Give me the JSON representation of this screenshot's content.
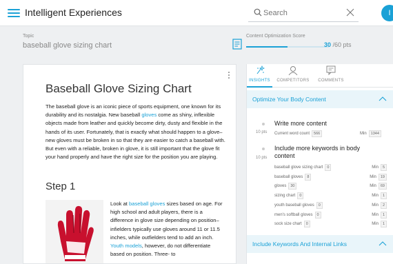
{
  "header": {
    "app_title": "Intelligent Experiences",
    "search_placeholder": "Search",
    "avatar_initial": "I",
    "accent": "#1aa1d6"
  },
  "topic": {
    "label": "Topic",
    "value": "baseball glove sizing chart"
  },
  "score": {
    "label": "Content Optimization Score",
    "value": "30",
    "suffix": "/60 pts",
    "fraction": 0.5
  },
  "article": {
    "title": "Baseball Glove Sizing Chart",
    "intro_1": "The baseball glove is an iconic piece of sports equipment, one known for its durability and its nostalgia. New baseball ",
    "intro_link": "gloves",
    "intro_2": " come as shiny, inflexible objects made from leather and quickly become dirty, dusty and flexible in the hands of its user. Fortunately, that is exactly what should happen to a glove– new gloves must be broken in so that they are easier to catch a baseball with. But even with a reliable, broken in glove, it is still important that the glove fit your hand properly and have the right size for the position you are playing.",
    "step_heading": "Step 1",
    "step_1": "Look at ",
    "step_link_1": "baseball gloves",
    "step_2": " sizes based on age. For high school and adult players, there is a difference in glove size depending on position– infielders typically use gloves around 11 or 11.5 inches, while outfielders tend to add an inch. ",
    "step_link_2": "Youth models",
    "step_3": ", however, do not differentiate based on position. Three- to"
  },
  "panel": {
    "tabs": [
      {
        "label": "INSIGHTS",
        "icon": "sparkle-icon"
      },
      {
        "label": "COMPETITORS",
        "icon": "users-icon"
      },
      {
        "label": "COMMENTS",
        "icon": "comment-icon"
      }
    ],
    "section_1": {
      "title": "Optimize Your Body Content",
      "task_1": {
        "title": "Write more content",
        "points": "10 pts",
        "sub_label": "Current word count",
        "current": "566",
        "min_label": "Min",
        "min_value": "1344"
      },
      "task_2": {
        "title_line_1": "Include more keywords in body",
        "title_line_2": "content",
        "points": "10 pts",
        "keywords": [
          {
            "term": "baseball glove sizing chart",
            "count": "0",
            "min_label": "Min",
            "min": "5"
          },
          {
            "term": "baseball gloves",
            "count": "8",
            "min_label": "Min",
            "min": "19"
          },
          {
            "term": "gloves",
            "count": "30",
            "min_label": "Min",
            "min": "69"
          },
          {
            "term": "sizing chart",
            "count": "0",
            "min_label": "Min",
            "min": "1"
          },
          {
            "term": "youth baseball gloves",
            "count": "0",
            "min_label": "Min",
            "min": "2"
          },
          {
            "term": "men's softball gloves",
            "count": "0",
            "min_label": "Min",
            "min": "1"
          },
          {
            "term": "sock size chart",
            "count": "0",
            "min_label": "Min",
            "min": "1"
          }
        ]
      }
    },
    "section_2": {
      "title": "Include Keywords And Internal Links"
    }
  }
}
